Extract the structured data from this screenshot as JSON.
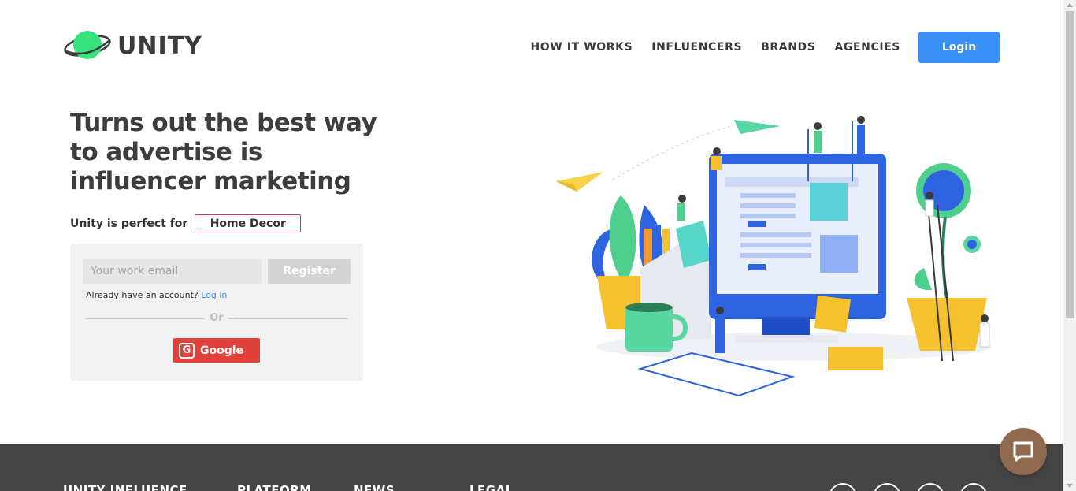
{
  "brand": {
    "name": "UNITY"
  },
  "nav": {
    "items": [
      "HOW IT WORKS",
      "INFLUENCERS",
      "BRANDS",
      "AGENCIES"
    ],
    "login_label": "Login"
  },
  "hero": {
    "headline": "Turns out the best way to advertise is influencer marketing",
    "perfect_for_label": "Unity is perfect for",
    "perfect_for_value": "Home Decor"
  },
  "signup": {
    "email_placeholder": "Your work email",
    "register_label": "Register",
    "have_account_text": "Already have an account?",
    "login_link": "Log in",
    "or_text": "Or",
    "google_label": "Google",
    "google_icon_letter": "G"
  },
  "footer": {
    "columns": [
      "UNITY INFLUENCE",
      "PLATFORM",
      "NEWS",
      "LEGAL"
    ]
  },
  "colors": {
    "accent": "#3a8ff4",
    "google": "#e0413a",
    "rotator_border": "#d2375b",
    "footer_bg": "#454545",
    "chat_bg": "#8f6a4f"
  },
  "icons": [
    "unity-logo-icon",
    "google-icon",
    "chat-icon",
    "social-icon"
  ]
}
